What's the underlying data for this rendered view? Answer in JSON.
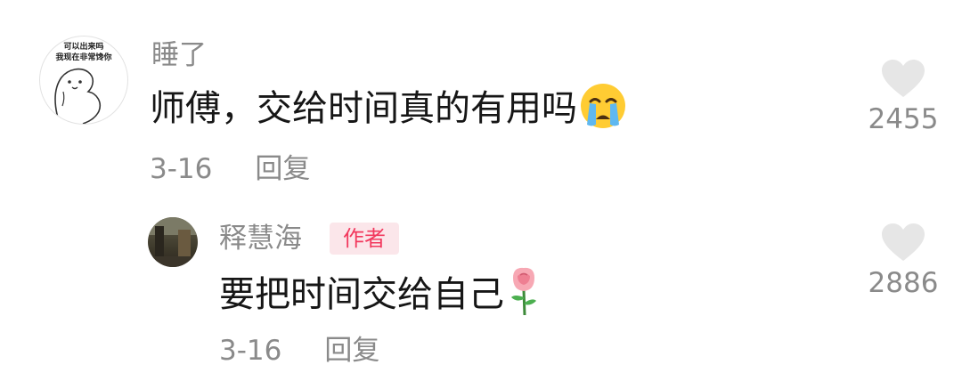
{
  "comment": {
    "avatar_caption_line1": "可以出来吗",
    "avatar_caption_line2": "我现在非常馋你",
    "username": "睡了",
    "text": "师傅，交给时间真的有用吗",
    "emoji": "crying-face-emoji",
    "date": "3-16",
    "reply_label": "回复",
    "likes": "2455"
  },
  "reply": {
    "username": "释慧海",
    "author_badge": "作者",
    "text": "要把时间交给自己",
    "emoji": "rose-emoji",
    "date": "3-16",
    "reply_label": "回复",
    "likes": "2886"
  },
  "colors": {
    "meta_gray": "#8a8a8a",
    "text_dark": "#161616",
    "badge_bg": "#fbe6ea",
    "badge_text": "#f2395e",
    "heart_gray": "#e6e6e6"
  }
}
